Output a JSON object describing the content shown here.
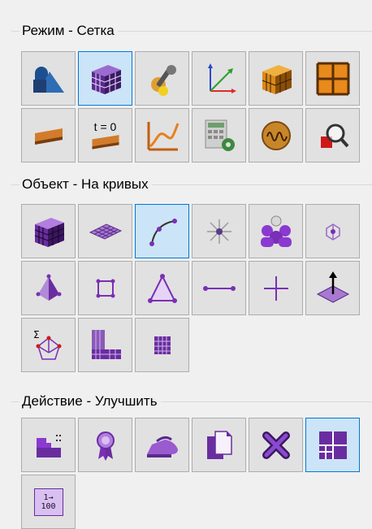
{
  "groups": [
    {
      "title": "Режим - Сетка",
      "buttons": [
        {
          "icon": "geometry-shapes-icon",
          "selected": false
        },
        {
          "icon": "mesh-cube-icon",
          "selected": true
        },
        {
          "icon": "mesh-tools-icon",
          "selected": false
        },
        {
          "icon": "coordinate-axes-icon",
          "selected": false
        },
        {
          "icon": "orange-cube-icon",
          "selected": false
        },
        {
          "icon": "grid-frame-icon",
          "selected": false
        },
        {
          "icon": "slanted-plank-icon",
          "selected": false
        },
        {
          "icon": "time-zero-icon",
          "label": "t = 0",
          "selected": false
        },
        {
          "icon": "graph-curve-icon",
          "selected": false
        },
        {
          "icon": "calculator-gear-icon",
          "selected": false
        },
        {
          "icon": "wave-circle-icon",
          "selected": false
        },
        {
          "icon": "magnifier-icon",
          "selected": false
        }
      ]
    },
    {
      "title": "Объект - На кривых",
      "buttons": [
        {
          "icon": "purple-cube-icon",
          "selected": false
        },
        {
          "icon": "mesh-plane-icon",
          "selected": false
        },
        {
          "icon": "curve-points-icon",
          "selected": true
        },
        {
          "icon": "star-node-icon",
          "selected": false
        },
        {
          "icon": "node-group-icon",
          "selected": false
        },
        {
          "icon": "small-node-icon",
          "selected": false
        },
        {
          "icon": "pyramid-icon",
          "selected": false
        },
        {
          "icon": "square-frame-icon",
          "selected": false
        },
        {
          "icon": "triangle-icon",
          "selected": false
        },
        {
          "icon": "line-segment-icon",
          "selected": false
        },
        {
          "icon": "cross-point-icon",
          "selected": false
        },
        {
          "icon": "up-arrow-plane-icon",
          "selected": false
        },
        {
          "icon": "sigma-network-icon",
          "selected": false
        },
        {
          "icon": "corner-grid-icon",
          "selected": false
        },
        {
          "icon": "small-grid-icon",
          "selected": false
        }
      ]
    },
    {
      "title": "Действие - Улучшить",
      "buttons": [
        {
          "icon": "staircase-grid-icon",
          "selected": false
        },
        {
          "icon": "award-ribbon-icon",
          "selected": false
        },
        {
          "icon": "iron-icon",
          "selected": false
        },
        {
          "icon": "copy-pages-icon",
          "selected": false
        },
        {
          "icon": "delete-x-icon",
          "selected": false
        },
        {
          "icon": "split-squares-icon",
          "selected": true
        },
        {
          "icon": "numbering-icon",
          "label": "1→ 100",
          "selected": false
        }
      ]
    }
  ],
  "colors": {
    "purple": "#7a2fb5",
    "dark_purple": "#3c1660",
    "light_purple": "#c79ae8",
    "orange": "#e08a1e",
    "selection": "#cce4f7",
    "selection_border": "#0078d7"
  }
}
